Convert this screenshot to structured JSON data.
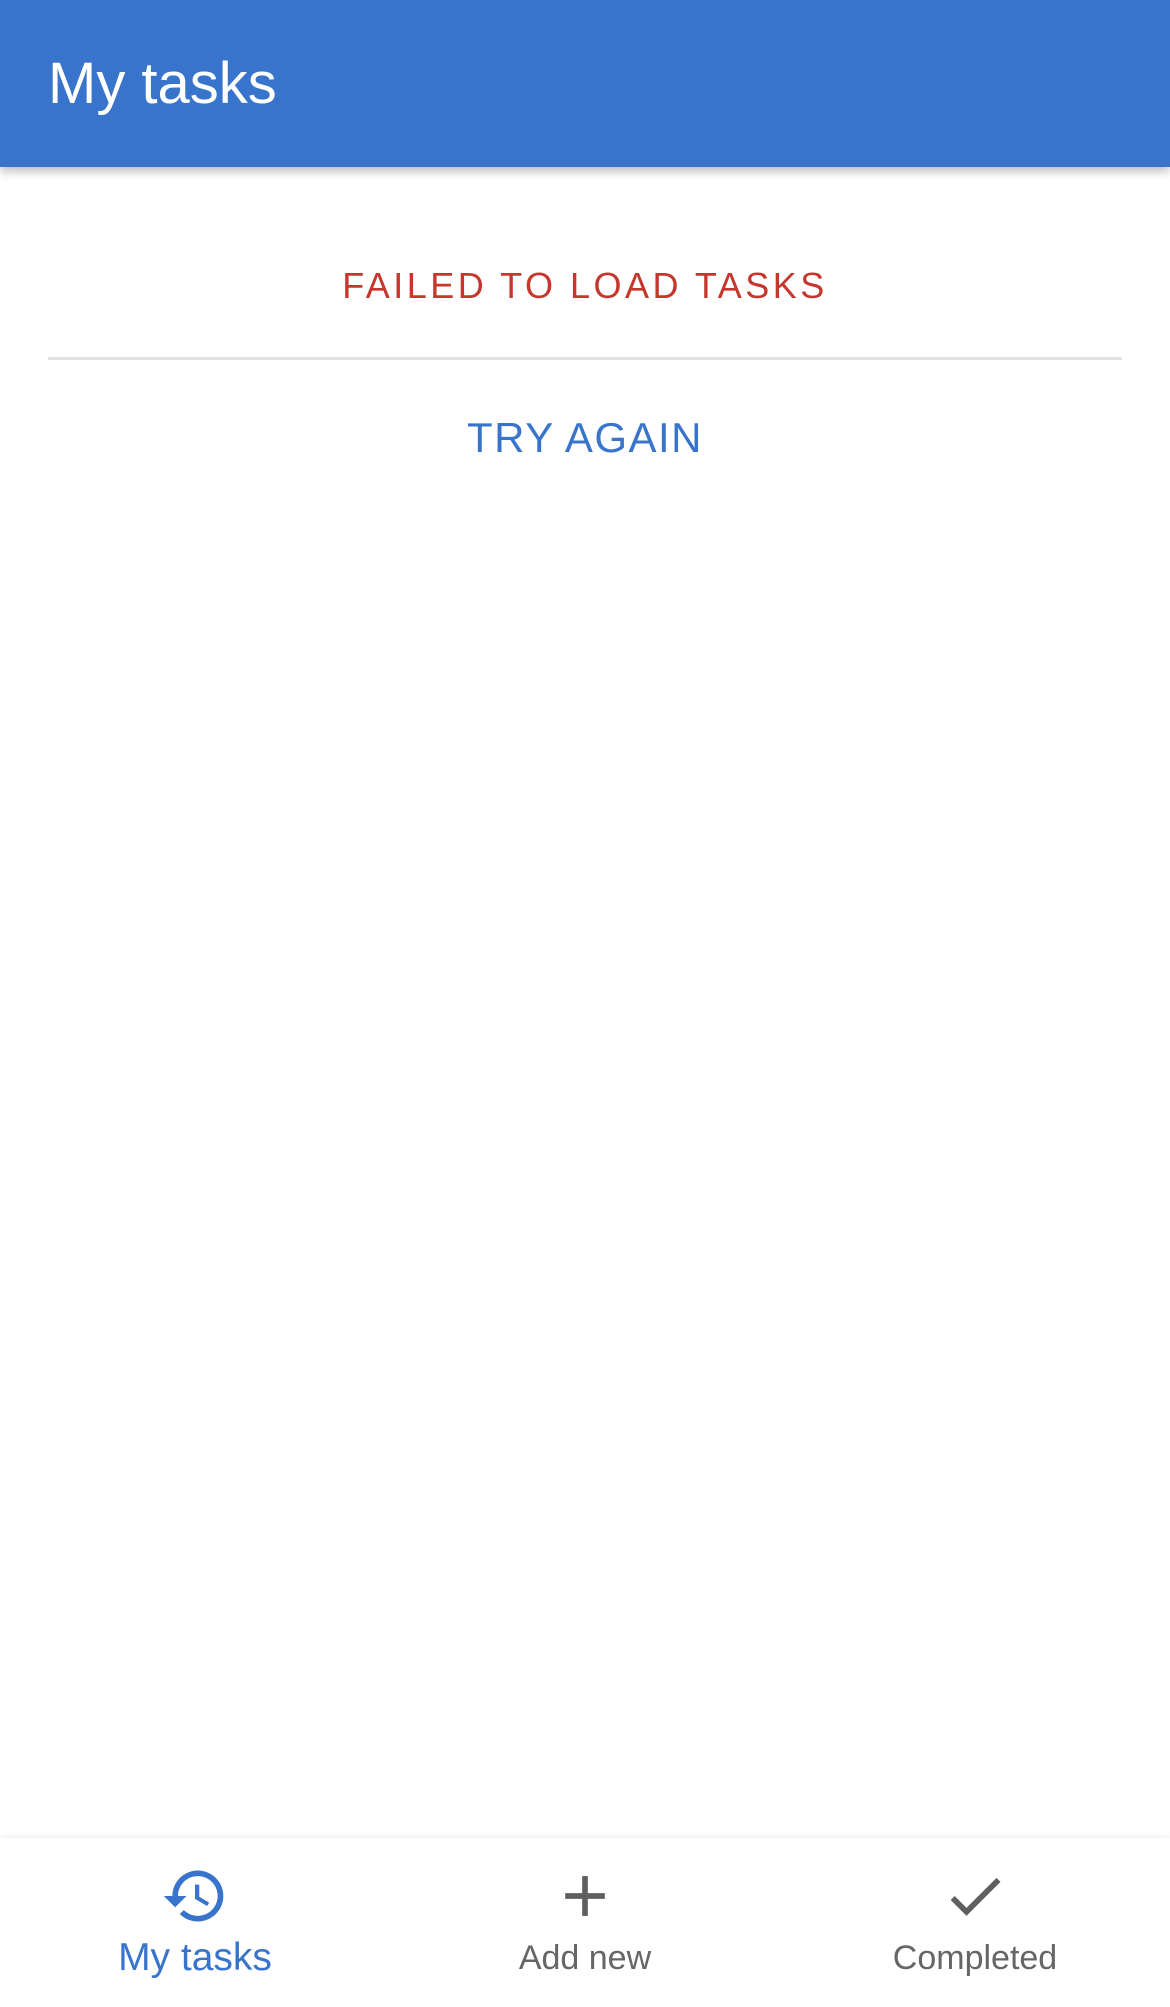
{
  "app_bar": {
    "title": "My tasks",
    "background_color": "#3874cc"
  },
  "main": {
    "error_message": "FAILED TO LOAD TASKS",
    "error_color": "#c5372c",
    "retry_label": "TRY AGAIN"
  },
  "bottom_nav": {
    "active_index": 0,
    "items": [
      {
        "label": "My tasks",
        "icon": "history-icon",
        "active": true
      },
      {
        "label": "Add new",
        "icon": "plus-icon",
        "active": false
      },
      {
        "label": "Completed",
        "icon": "checkmark-icon",
        "active": false
      }
    ]
  }
}
